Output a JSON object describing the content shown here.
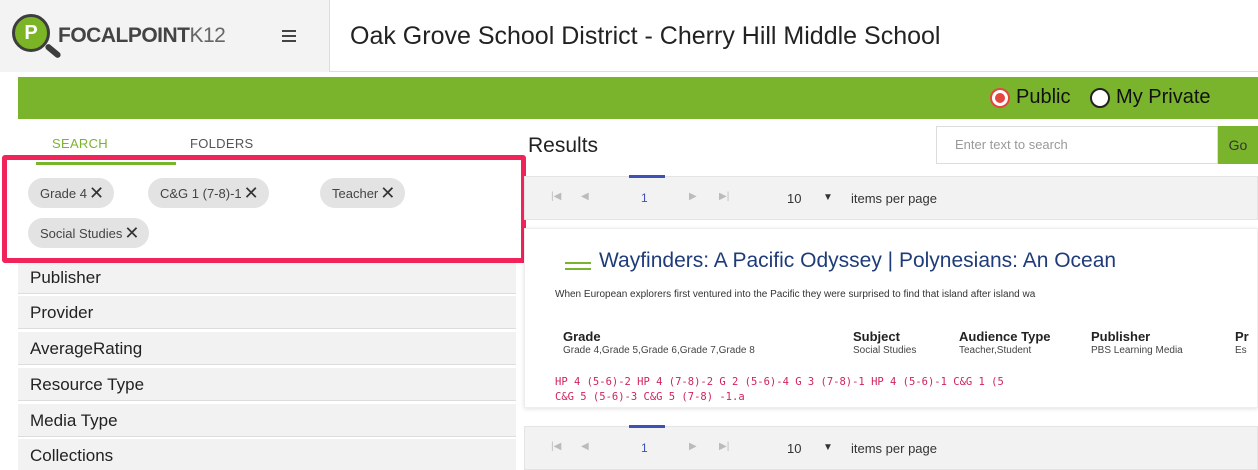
{
  "header": {
    "logo_text": "FOCALPOINT",
    "logo_suffix": "K12",
    "logo_mark": "P",
    "menu_icon": "hamburger-icon",
    "title": "Oak Grove School District - Cherry Hill Middle School"
  },
  "visibility": {
    "options": [
      "Public",
      "My Private"
    ],
    "selected": "Public"
  },
  "sidebar": {
    "tabs": [
      {
        "label": "SEARCH",
        "active": true
      },
      {
        "label": "FOLDERS",
        "active": false
      }
    ],
    "chips": [
      {
        "label": "Grade 4"
      },
      {
        "label": "C&G 1 (7-8)-1"
      },
      {
        "label": "Teacher"
      },
      {
        "label": "Social Studies"
      }
    ],
    "chip_remove_icon": "close-icon",
    "facets": [
      "Publisher",
      "Provider",
      "AverageRating",
      "Resource Type",
      "Media Type",
      "Collections"
    ]
  },
  "main": {
    "title": "Results",
    "search": {
      "placeholder": "Enter text to search",
      "button_label": "Go"
    },
    "pager": {
      "current_page": "1",
      "page_size": "10",
      "items_label": "items per page",
      "icons": [
        "first-page-icon",
        "prev-page-icon",
        "next-page-icon",
        "last-page-icon"
      ]
    },
    "result": {
      "title": "Wayfinders: A Pacific Odyssey | Polynesians: An Ocean",
      "description": "When European explorers first ventured into the Pacific they were surprised to find that island after island wa",
      "columns": [
        {
          "head": "Grade",
          "value": "Grade 4,Grade 5,Grade 6,Grade 7,Grade 8"
        },
        {
          "head": "Subject",
          "value": "Social Studies"
        },
        {
          "head": "Audience Type",
          "value": "Teacher,Student"
        },
        {
          "head": "Publisher",
          "value": "PBS Learning Media"
        },
        {
          "head": "Pr",
          "value": "Es"
        }
      ],
      "standards_line1": "HP 4 (5-6)-2  HP 4 (7-8)-2  G 2 (5-6)-4  G 3 (7-8)-1  HP 4 (5-6)-1  C&G 1 (5",
      "standards_line2": "C&G 5 (5-6)-3  C&G 5 (7-8) -1.a"
    }
  },
  "colors": {
    "brand_green": "#7ab42d",
    "highlight": "#f0245b",
    "link_blue": "#1f3c7a",
    "standard_red": "#d0245c",
    "pager_blue": "#3e51b5"
  }
}
